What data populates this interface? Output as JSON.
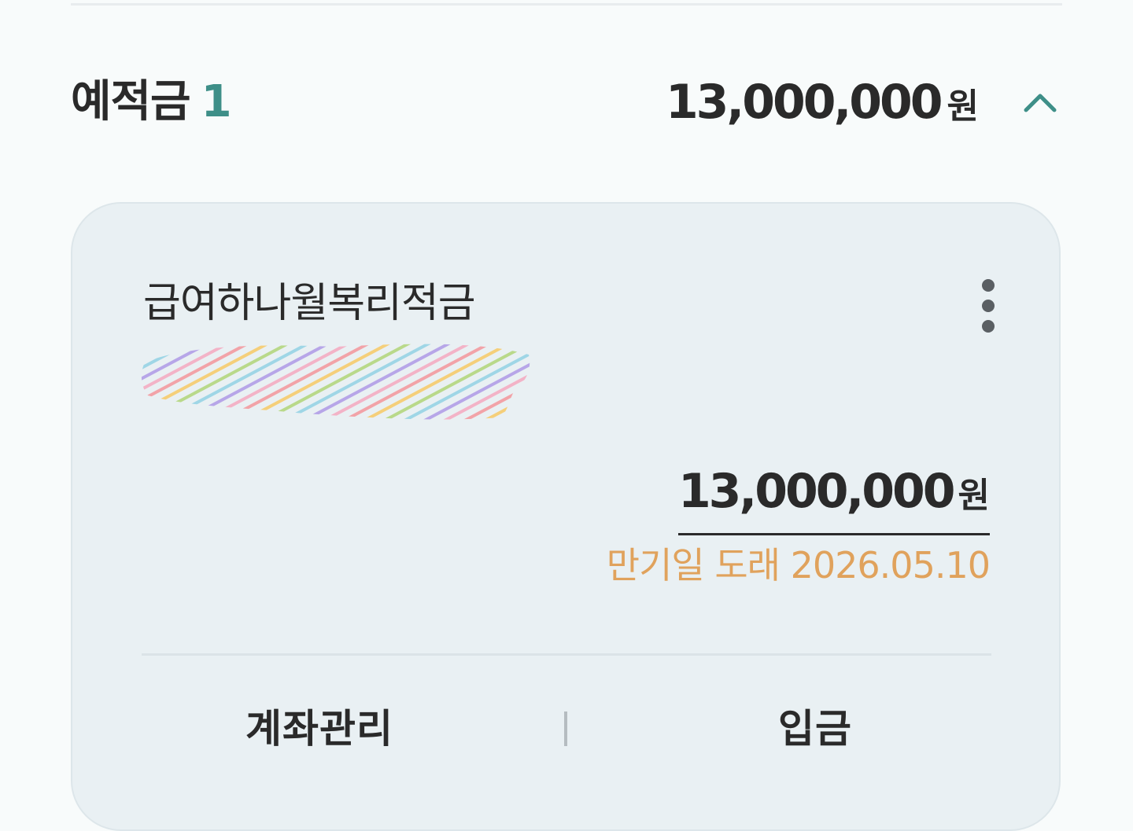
{
  "section": {
    "title": "예적금",
    "count": "1",
    "total_amount": "13,000,000",
    "total_unit": "원",
    "toggle_icon": "chevron-up-icon",
    "accent_color": "#3e8f88"
  },
  "account": {
    "product_name": "급여하나월복리적금",
    "account_number_masked": true,
    "balance": "13,000,000",
    "balance_unit": "원",
    "maturity_text": "만기일 도래 2026.05.10",
    "maturity_color": "#e0a25c",
    "menu_icon": "more-vertical-icon"
  },
  "actions": {
    "manage_label": "계좌관리",
    "deposit_label": "입금"
  }
}
